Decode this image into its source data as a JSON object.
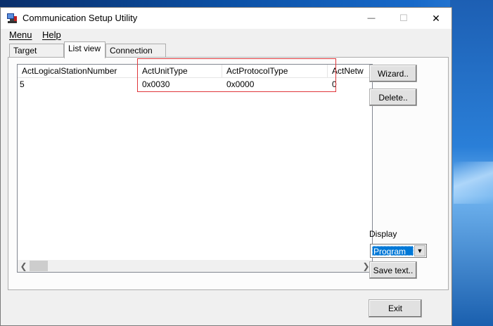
{
  "window": {
    "title": "Communication Setup Utility",
    "minimize_glyph": "—",
    "maximize_glyph": "☐",
    "close_glyph": "✕"
  },
  "menu": {
    "items": [
      {
        "label": "Menu"
      },
      {
        "label": "Help"
      }
    ]
  },
  "tabs": [
    {
      "label": "Target setting",
      "active": false
    },
    {
      "label": "List view",
      "active": true
    },
    {
      "label": "Connection test",
      "active": false
    }
  ],
  "list": {
    "columns": [
      "ActLogicalStationNumber",
      "ActUnitType",
      "ActProtocolType",
      "ActNetw"
    ],
    "rows": [
      [
        "5",
        "0x0030",
        "0x0000",
        "0"
      ]
    ]
  },
  "buttons": {
    "wizard": "Wizard..",
    "delete": "Delete..",
    "save_text": "Save text..",
    "exit": "Exit"
  },
  "display": {
    "label": "Display",
    "selected": "Program"
  },
  "colors": {
    "accent": "#0078d7",
    "highlight_box": "#e0373b"
  }
}
